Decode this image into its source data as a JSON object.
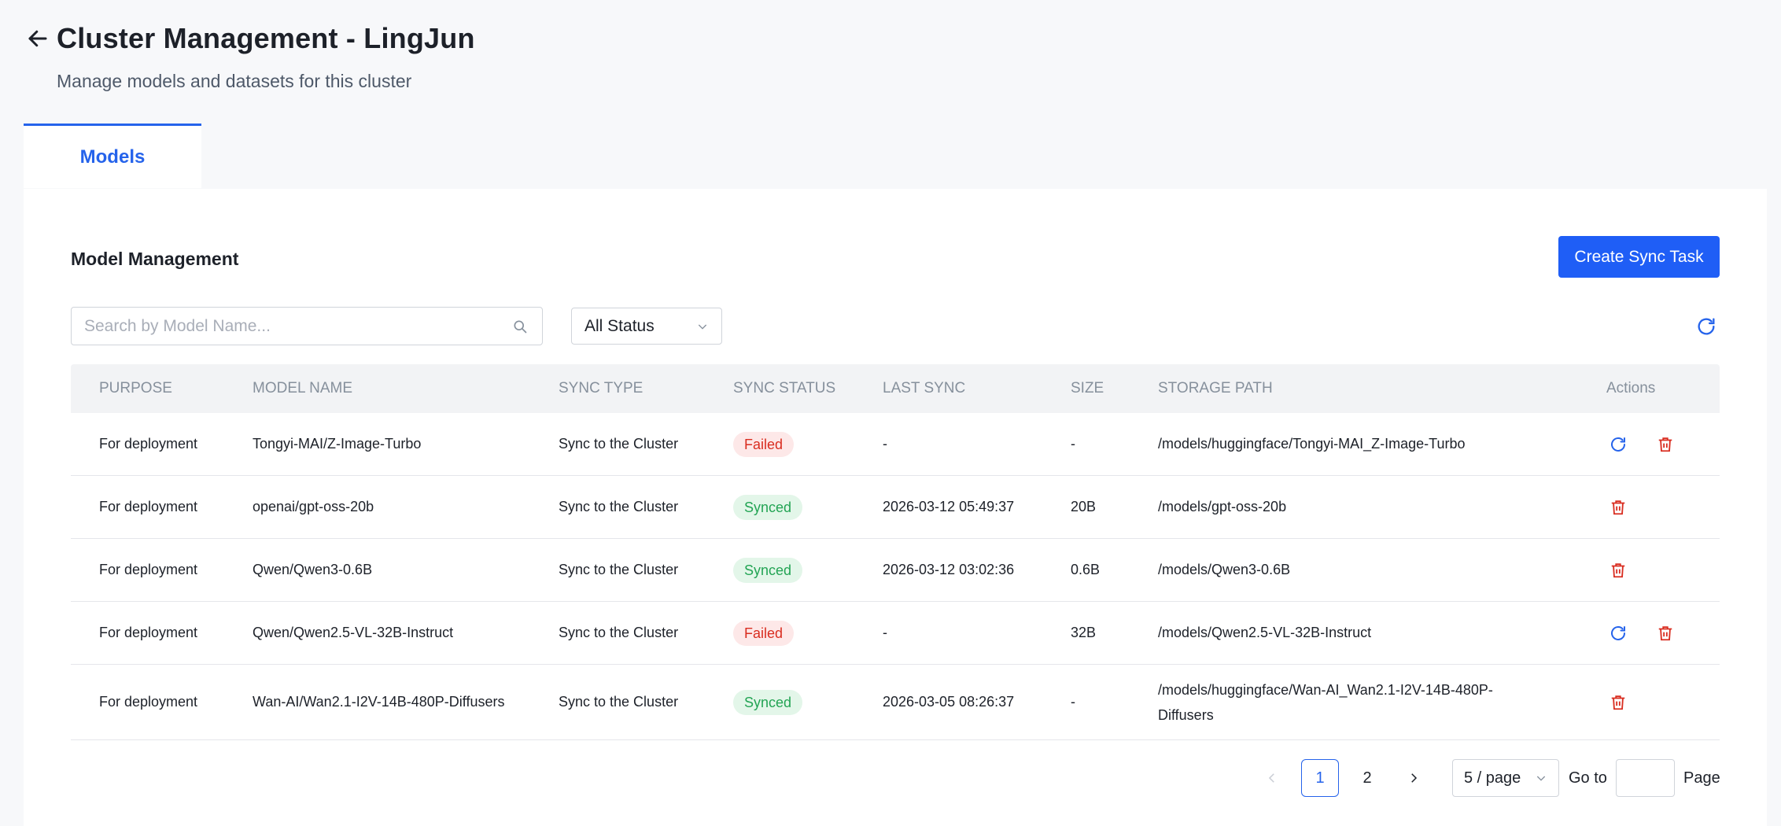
{
  "header": {
    "title": "Cluster Management - LingJun",
    "subtitle": "Manage models and datasets for this cluster"
  },
  "tabs": [
    {
      "label": "Models",
      "active": true
    }
  ],
  "section": {
    "title": "Model Management",
    "create_label": "Create Sync Task"
  },
  "filters": {
    "search_placeholder": "Search by Model Name...",
    "status_value": "All Status"
  },
  "table": {
    "columns": [
      "PURPOSE",
      "MODEL NAME",
      "SYNC TYPE",
      "SYNC STATUS",
      "LAST SYNC",
      "SIZE",
      "STORAGE PATH",
      "Actions"
    ],
    "rows": [
      {
        "purpose": "For deployment",
        "model": "Tongyi-MAI/Z-Image-Turbo",
        "sync_type": "Sync to the Cluster",
        "status": "Failed",
        "last_sync": "-",
        "size": "-",
        "path": "/models/huggingface/Tongyi-MAI_Z-Image-Turbo"
      },
      {
        "purpose": "For deployment",
        "model": "openai/gpt-oss-20b",
        "sync_type": "Sync to the Cluster",
        "status": "Synced",
        "last_sync": "2026-03-12 05:49:37",
        "size": "20B",
        "path": "/models/gpt-oss-20b"
      },
      {
        "purpose": "For deployment",
        "model": "Qwen/Qwen3-0.6B",
        "sync_type": "Sync to the Cluster",
        "status": "Synced",
        "last_sync": "2026-03-12 03:02:36",
        "size": "0.6B",
        "path": "/models/Qwen3-0.6B"
      },
      {
        "purpose": "For deployment",
        "model": "Qwen/Qwen2.5-VL-32B-Instruct",
        "sync_type": "Sync to the Cluster",
        "status": "Failed",
        "last_sync": "-",
        "size": "32B",
        "path": "/models/Qwen2.5-VL-32B-Instruct"
      },
      {
        "purpose": "For deployment",
        "model": "Wan-AI/Wan2.1-I2V-14B-480P-Diffusers",
        "sync_type": "Sync to the Cluster",
        "status": "Synced",
        "last_sync": "2026-03-05 08:26:37",
        "size": "-",
        "path": "/models/huggingface/Wan-AI_Wan2.1-I2V-14B-480P-Diffusers"
      }
    ]
  },
  "pagination": {
    "pages": [
      "1",
      "2"
    ],
    "current": "1",
    "page_size": "5 / page",
    "goto_label": "Go to",
    "page_label": "Page"
  },
  "colors": {
    "primary": "#1f5ef6",
    "failed_bg": "#fde8e8",
    "failed_text": "#d92d20",
    "synced_bg": "#e3f6e9",
    "synced_text": "#23a454",
    "delete_icon": "#d92d20",
    "retry_icon": "#2563eb"
  },
  "icons": {
    "back": "arrow-left-icon",
    "search": "search-icon",
    "dropdown": "chevron-down-icon",
    "refresh": "refresh-icon",
    "retry": "retry-icon",
    "delete": "trash-icon",
    "prev": "chevron-left-icon",
    "next": "chevron-right-icon"
  }
}
